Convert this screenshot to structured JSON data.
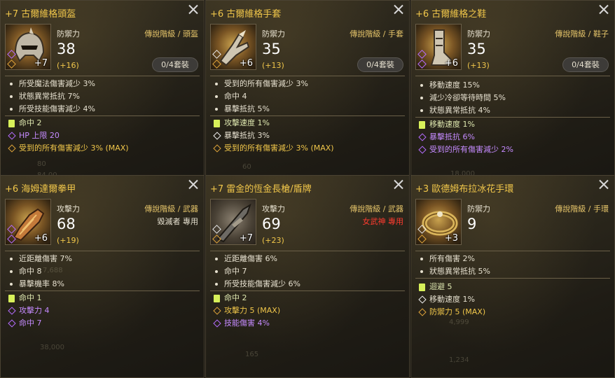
{
  "labels": {
    "grade": "傳說階級",
    "set": "0/4套裝"
  },
  "cards": [
    {
      "title": "+7 古爾維格頭盔",
      "stat_label": "防禦力",
      "stat_value": "38",
      "bonus": "(+16)",
      "grade": "傳說階級 / 頭盔",
      "enhance": "+7",
      "base": [
        "所受魔法傷害減少 3%",
        "狀態異常抵抗 7%",
        "所受技能傷害減少 4%"
      ],
      "extra": [
        {
          "text": "命中 2",
          "kind": "g"
        },
        {
          "text": "HP 上限 20",
          "kind": "p"
        },
        {
          "text": "受到的所有傷害減少 3% (MAX)",
          "kind": "o"
        }
      ],
      "ghost": [
        "80",
        "84 00"
      ]
    },
    {
      "title": "+6 古爾維格手套",
      "stat_label": "防禦力",
      "stat_value": "35",
      "bonus": "(+13)",
      "grade": "傳說階級 / 手套",
      "enhance": "+6",
      "base": [
        "受到的所有傷害減少 3%",
        "命中 4",
        "暴擊抵抗 5%"
      ],
      "extra": [
        {
          "text": "攻擊速度 1%",
          "kind": "g"
        },
        {
          "text": "暴擊抵抗 3%",
          "kind": "w"
        },
        {
          "text": "受到的所有傷害減少 3% (MAX)",
          "kind": "o"
        }
      ],
      "ghost": [
        "60",
        ""
      ]
    },
    {
      "title": "+6 古爾維格之鞋",
      "stat_label": "防禦力",
      "stat_value": "35",
      "bonus": "(+13)",
      "grade": "傳說階級 / 鞋子",
      "enhance": "+6",
      "base": [
        "移動速度 15%",
        "減少冷卻等待時間 5%",
        "狀態異常抵抗 4%"
      ],
      "extra": [
        {
          "text": "移動速度 1%",
          "kind": "g"
        },
        {
          "text": "暴擊抵抗 6%",
          "kind": "p"
        },
        {
          "text": "受到的所有傷害減少 2%",
          "kind": "p"
        }
      ],
      "ghost": [
        "18,000",
        ""
      ]
    },
    {
      "title": "+6 海姆達爾拳甲",
      "stat_label": "攻擊力",
      "stat_value": "68",
      "bonus": "(+19)",
      "grade": "傳說階級 / 武器",
      "exclusive": "毀滅者 專用",
      "excl_red": false,
      "enhance": "+6",
      "base": [
        "近距離傷害 7%",
        "命中 8",
        "暴擊機率 8%"
      ],
      "extra": [
        {
          "text": "命中 1",
          "kind": "g"
        },
        {
          "text": "攻擊力 4",
          "kind": "p"
        },
        {
          "text": "命中 7",
          "kind": "p"
        }
      ],
      "ghost": [
        "38,000",
        "7,688"
      ]
    },
    {
      "title": "+7 雷金的恆金長槍/盾牌",
      "stat_label": "攻擊力",
      "stat_value": "69",
      "bonus": "(+23)",
      "grade": "傳說階級 / 武器",
      "exclusive": "女武神 專用",
      "excl_red": true,
      "enhance": "+7",
      "base": [
        "近距離傷害 6%",
        "命中 7",
        "所受技能傷害減少 6%"
      ],
      "extra": [
        {
          "text": "命中 2",
          "kind": "g"
        },
        {
          "text": "攻擊力 5 (MAX)",
          "kind": "o"
        },
        {
          "text": "技能傷害 4%",
          "kind": "p"
        }
      ],
      "ghost": [
        "165",
        ""
      ]
    },
    {
      "title": "+3 歐德姆布拉冰花手環",
      "stat_label": "防禦力",
      "stat_value": "9",
      "bonus": "",
      "grade": "傳說階級 / 手環",
      "enhance": "+3",
      "base": [
        "所有傷害 2%",
        "狀態異常抵抗 5%"
      ],
      "extra": [
        {
          "text": "迴避 5",
          "kind": "g"
        },
        {
          "text": "移動速度 1%",
          "kind": "w"
        },
        {
          "text": "防禦力 5 (MAX)",
          "kind": "o"
        }
      ],
      "ghost": [
        "1,234",
        "4,999"
      ]
    }
  ]
}
